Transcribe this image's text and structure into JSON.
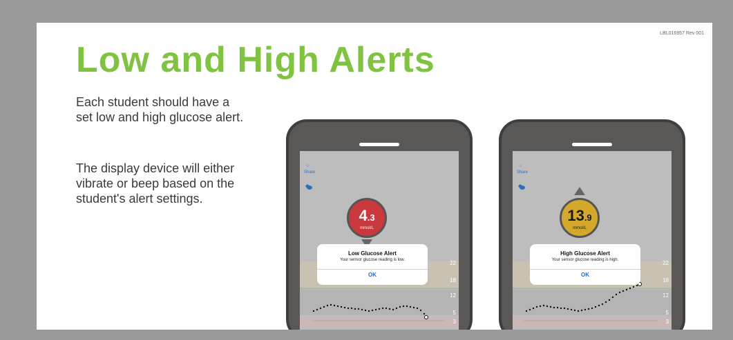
{
  "doc_id": "LBL016957 Rev 001",
  "title": "Low and High Alerts",
  "paragraphs": [
    "Each student should have a set low and high glucose alert.",
    "The display device will either vibrate or beep based on the student's alert settings."
  ],
  "phones": [
    {
      "share_label": "Share",
      "glucose_main": "4",
      "glucose_decimal": ".3",
      "unit": "mmol/L",
      "alert_title": "Low Glucose Alert",
      "alert_message": "Your sensor glucose reading is low.",
      "ok_label": "OK",
      "ticks": [
        "22",
        "18",
        "12",
        "5",
        "3"
      ]
    },
    {
      "share_label": "Share",
      "glucose_main": "13",
      "glucose_decimal": ".9",
      "unit": "mmol/L",
      "alert_title": "High Glucose Alert",
      "alert_message": "Your sensor glucose reading is high.",
      "ok_label": "OK",
      "ticks": [
        "22",
        "18",
        "12",
        "5",
        "3"
      ]
    }
  ],
  "colors": {
    "title_green": "#80c342",
    "low_red": "#c8383c",
    "high_gold": "#d4a92b",
    "link_blue": "#2d6fb8"
  }
}
